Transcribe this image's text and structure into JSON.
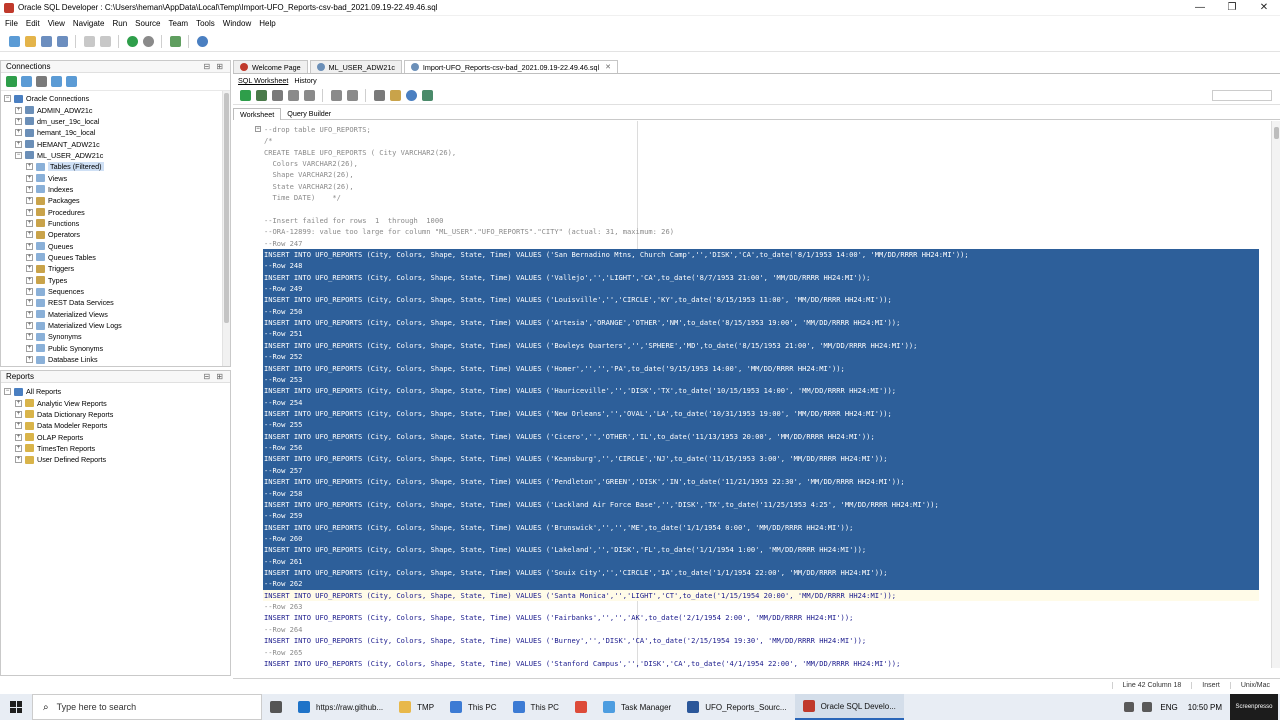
{
  "window": {
    "title": "Oracle SQL Developer : C:\\Users\\heman\\AppData\\Local\\Temp\\Import-UFO_Reports-csv-bad_2021.09.19-22.49.46.sql",
    "min": "—",
    "max": "❐",
    "close": "✕"
  },
  "menu": [
    "File",
    "Edit",
    "View",
    "Navigate",
    "Run",
    "Source",
    "Team",
    "Tools",
    "Window",
    "Help"
  ],
  "connections": {
    "title": "Connections",
    "controls": "⊟ ⊞",
    "items": [
      {
        "label": "Oracle Connections",
        "level": 0,
        "exp": "−",
        "icon": "#4a7fc1"
      },
      {
        "label": "ADMIN_ADW21c",
        "level": 1,
        "exp": "+",
        "icon": "#6b8fb8"
      },
      {
        "label": "dm_user_19c_local",
        "level": 1,
        "exp": "+",
        "icon": "#6b8fb8"
      },
      {
        "label": "hemant_19c_local",
        "level": 1,
        "exp": "+",
        "icon": "#6b8fb8"
      },
      {
        "label": "HEMANT_ADW21c",
        "level": 1,
        "exp": "+",
        "icon": "#6b8fb8"
      },
      {
        "label": "ML_USER_ADW21c",
        "level": 1,
        "exp": "−",
        "icon": "#6b8fb8"
      },
      {
        "label": "Tables (Filtered)",
        "level": 2,
        "exp": "+",
        "icon": "#8ab0d8",
        "selected": true
      },
      {
        "label": "Views",
        "level": 2,
        "exp": "+",
        "icon": "#8ab0d8"
      },
      {
        "label": "Indexes",
        "level": 2,
        "exp": "+",
        "icon": "#8ab0d8"
      },
      {
        "label": "Packages",
        "level": 2,
        "exp": "+",
        "icon": "#c9a34a"
      },
      {
        "label": "Procedures",
        "level": 2,
        "exp": "+",
        "icon": "#c9a34a"
      },
      {
        "label": "Functions",
        "level": 2,
        "exp": "+",
        "icon": "#c9a34a"
      },
      {
        "label": "Operators",
        "level": 2,
        "exp": "+",
        "icon": "#c9a34a"
      },
      {
        "label": "Queues",
        "level": 2,
        "exp": "+",
        "icon": "#8ab0d8"
      },
      {
        "label": "Queues Tables",
        "level": 2,
        "exp": "+",
        "icon": "#8ab0d8"
      },
      {
        "label": "Triggers",
        "level": 2,
        "exp": "+",
        "icon": "#c9a34a"
      },
      {
        "label": "Types",
        "level": 2,
        "exp": "+",
        "icon": "#c9a34a"
      },
      {
        "label": "Sequences",
        "level": 2,
        "exp": "+",
        "icon": "#8ab0d8"
      },
      {
        "label": "REST Data Services",
        "level": 2,
        "exp": "+",
        "icon": "#8ab0d8"
      },
      {
        "label": "Materialized Views",
        "level": 2,
        "exp": "+",
        "icon": "#8ab0d8"
      },
      {
        "label": "Materialized View Logs",
        "level": 2,
        "exp": "+",
        "icon": "#8ab0d8"
      },
      {
        "label": "Synonyms",
        "level": 2,
        "exp": "+",
        "icon": "#8ab0d8"
      },
      {
        "label": "Public Synonyms",
        "level": 2,
        "exp": "+",
        "icon": "#8ab0d8"
      },
      {
        "label": "Database Links",
        "level": 2,
        "exp": "+",
        "icon": "#8ab0d8"
      }
    ]
  },
  "reports": {
    "title": "Reports",
    "controls": "⊟ ⊞",
    "items": [
      {
        "label": "All Reports",
        "level": 0,
        "exp": "−",
        "icon": "#4a7fc1"
      },
      {
        "label": "Analytic View Reports",
        "level": 1,
        "exp": "+",
        "icon": "#d9b44a"
      },
      {
        "label": "Data Dictionary Reports",
        "level": 1,
        "exp": "+",
        "icon": "#d9b44a"
      },
      {
        "label": "Data Modeler Reports",
        "level": 1,
        "exp": "+",
        "icon": "#d9b44a"
      },
      {
        "label": "OLAP Reports",
        "level": 1,
        "exp": "+",
        "icon": "#d9b44a"
      },
      {
        "label": "TimesTen Reports",
        "level": 1,
        "exp": "+",
        "icon": "#d9b44a"
      },
      {
        "label": "User Defined Reports",
        "level": 1,
        "exp": "+",
        "icon": "#d9b44a"
      }
    ]
  },
  "doc_tabs": [
    {
      "label": "Welcome Page",
      "icon": "#c0392b",
      "active": false
    },
    {
      "label": "ML_USER_ADW21c",
      "icon": "#6b8fb8",
      "active": false
    },
    {
      "label": "Import-UFO_Reports-csv-bad_2021.09.19-22.49.46.sql",
      "icon": "#6b8fb8",
      "active": true
    }
  ],
  "sub_tabs": [
    "SQL Worksheet",
    "History"
  ],
  "ws_tabs": [
    "Worksheet",
    "Query Builder"
  ],
  "code_lines": [
    {
      "t": "--drop table UFO_REPORTS;",
      "s": "c"
    },
    {
      "t": "/*",
      "s": "c"
    },
    {
      "t": "CREATE TABLE UFO_REPORTS ( City VARCHAR2(26),",
      "s": "c"
    },
    {
      "t": "  Colors VARCHAR2(26),",
      "s": "c"
    },
    {
      "t": "  Shape VARCHAR2(26),",
      "s": "c"
    },
    {
      "t": "  State VARCHAR2(26),",
      "s": "c"
    },
    {
      "t": "  Time DATE)    */",
      "s": "c"
    },
    {
      "t": "",
      "s": "c"
    },
    {
      "t": "--Insert failed for rows  1  through  1000",
      "s": "c"
    },
    {
      "t": "--ORA-12899: value too large for column \"ML_USER\".\"UFO_REPORTS\".\"CITY\" (actual: 31, maximum: 26)",
      "s": "c"
    },
    {
      "t": "--Row 247",
      "s": "c"
    },
    {
      "t": "INSERT INTO UFO_REPORTS (City, Colors, Shape, State, Time) VALUES ('San Bernadino Mtns, Church Camp','','DISK','CA',to_date('8/1/1953 14:00', 'MM/DD/RRRR HH24:MI'));",
      "s": "hl"
    },
    {
      "t": "--Row 248",
      "s": "hl"
    },
    {
      "t": "INSERT INTO UFO_REPORTS (City, Colors, Shape, State, Time) VALUES ('Vallejo','','LIGHT','CA',to_date('8/7/1953 21:00', 'MM/DD/RRRR HH24:MI'));",
      "s": "hl"
    },
    {
      "t": "--Row 249",
      "s": "hl"
    },
    {
      "t": "INSERT INTO UFO_REPORTS (City, Colors, Shape, State, Time) VALUES ('Louisville','','CIRCLE','KY',to_date('8/15/1953 11:00', 'MM/DD/RRRR HH24:MI'));",
      "s": "hl"
    },
    {
      "t": "--Row 250",
      "s": "hl"
    },
    {
      "t": "INSERT INTO UFO_REPORTS (City, Colors, Shape, State, Time) VALUES ('Artesia','ORANGE','OTHER','NM',to_date('8/15/1953 19:00', 'MM/DD/RRRR HH24:MI'));",
      "s": "hl"
    },
    {
      "t": "--Row 251",
      "s": "hl"
    },
    {
      "t": "INSERT INTO UFO_REPORTS (City, Colors, Shape, State, Time) VALUES ('Bowleys Quarters','','SPHERE','MD',to_date('8/15/1953 21:00', 'MM/DD/RRRR HH24:MI'));",
      "s": "hl"
    },
    {
      "t": "--Row 252",
      "s": "hl"
    },
    {
      "t": "INSERT INTO UFO_REPORTS (City, Colors, Shape, State, Time) VALUES ('Homer','','','PA',to_date('9/15/1953 14:00', 'MM/DD/RRRR HH24:MI'));",
      "s": "hl"
    },
    {
      "t": "--Row 253",
      "s": "hl"
    },
    {
      "t": "INSERT INTO UFO_REPORTS (City, Colors, Shape, State, Time) VALUES ('Hauriceville','','DISK','TX',to_date('10/15/1953 14:00', 'MM/DD/RRRR HH24:MI'));",
      "s": "hl"
    },
    {
      "t": "--Row 254",
      "s": "hl"
    },
    {
      "t": "INSERT INTO UFO_REPORTS (City, Colors, Shape, State, Time) VALUES ('New Orleans','','OVAL','LA',to_date('10/31/1953 19:00', 'MM/DD/RRRR HH24:MI'));",
      "s": "hl"
    },
    {
      "t": "--Row 255",
      "s": "hl"
    },
    {
      "t": "INSERT INTO UFO_REPORTS (City, Colors, Shape, State, Time) VALUES ('Cicero','','OTHER','IL',to_date('11/13/1953 20:00', 'MM/DD/RRRR HH24:MI'));",
      "s": "hl"
    },
    {
      "t": "--Row 256",
      "s": "hl"
    },
    {
      "t": "INSERT INTO UFO_REPORTS (City, Colors, Shape, State, Time) VALUES ('Keansburg','','CIRCLE','NJ',to_date('11/15/1953 3:00', 'MM/DD/RRRR HH24:MI'));",
      "s": "hl"
    },
    {
      "t": "--Row 257",
      "s": "hl"
    },
    {
      "t": "INSERT INTO UFO_REPORTS (City, Colors, Shape, State, Time) VALUES ('Pendleton','GREEN','DISK','IN',to_date('11/21/1953 22:30', 'MM/DD/RRRR HH24:MI'));",
      "s": "hl"
    },
    {
      "t": "--Row 258",
      "s": "hl"
    },
    {
      "t": "INSERT INTO UFO_REPORTS (City, Colors, Shape, State, Time) VALUES ('Lackland Air Force Base','','DISK','TX',to_date('11/25/1953 4:25', 'MM/DD/RRRR HH24:MI'));",
      "s": "hl"
    },
    {
      "t": "--Row 259",
      "s": "hl"
    },
    {
      "t": "INSERT INTO UFO_REPORTS (City, Colors, Shape, State, Time) VALUES ('Brunswick','','','ME',to_date('1/1/1954 0:00', 'MM/DD/RRRR HH24:MI'));",
      "s": "hl"
    },
    {
      "t": "--Row 260",
      "s": "hl"
    },
    {
      "t": "INSERT INTO UFO_REPORTS (City, Colors, Shape, State, Time) VALUES ('Lakeland','','DISK','FL',to_date('1/1/1954 1:00', 'MM/DD/RRRR HH24:MI'));",
      "s": "hl"
    },
    {
      "t": "--Row 261",
      "s": "hl"
    },
    {
      "t": "INSERT INTO UFO_REPORTS (City, Colors, Shape, State, Time) VALUES ('Souix City','','CIRCLE','IA',to_date('1/1/1954 22:00', 'MM/DD/RRRR HH24:MI'));",
      "s": "hl"
    },
    {
      "t": "--Row 262",
      "s": "hl"
    },
    {
      "t": "INSERT INTO UFO_REPORTS (City, Colors, Shape, State, Time) VALUES ('Santa Monica','','LIGHT','CT',to_date('1/15/1954 20:00', 'MM/DD/RRRR HH24:MI'));",
      "s": "cur"
    },
    {
      "t": "--Row 263",
      "s": "c"
    },
    {
      "t": "INSERT INTO UFO_REPORTS (City, Colors, Shape, State, Time) VALUES ('Fairbanks','','','AK',to_date('2/1/1954 2:00', 'MM/DD/RRRR HH24:MI'));",
      "s": "k"
    },
    {
      "t": "--Row 264",
      "s": "c"
    },
    {
      "t": "INSERT INTO UFO_REPORTS (City, Colors, Shape, State, Time) VALUES ('Burney','','DISK','CA',to_date('2/15/1954 19:30', 'MM/DD/RRRR HH24:MI'));",
      "s": "k"
    },
    {
      "t": "--Row 265",
      "s": "c"
    },
    {
      "t": "INSERT INTO UFO_REPORTS (City, Colors, Shape, State, Time) VALUES ('Stanford Campus','','DISK','CA',to_date('4/1/1954 22:00', 'MM/DD/RRRR HH24:MI'));",
      "s": "k"
    }
  ],
  "status": {
    "position": "Line 42 Column 18",
    "mode": "Insert",
    "line_ending": "Unix/Mac"
  },
  "taskbar": {
    "search_placeholder": "Type here to search",
    "items": [
      {
        "label": "",
        "icon": "#555555",
        "name": "task-view"
      },
      {
        "label": "https://raw.github...",
        "icon": "#1e73c8",
        "name": "edge-browser"
      },
      {
        "label": "TMP",
        "icon": "#e8b84a",
        "name": "explorer-tmp"
      },
      {
        "label": "This PC",
        "icon": "#3c7bd4",
        "name": "explorer-this-pc-1"
      },
      {
        "label": "This PC",
        "icon": "#3c7bd4",
        "name": "explorer-this-pc-2"
      },
      {
        "label": "",
        "icon": "#dd4b39",
        "name": "chrome"
      },
      {
        "label": "Task Manager",
        "icon": "#4d9de0",
        "name": "task-manager"
      },
      {
        "label": "UFO_Reports_Sourc...",
        "icon": "#2b579a",
        "name": "ufo-reports-source"
      },
      {
        "label": "Oracle SQL Develo...",
        "icon": "#c0392b",
        "name": "oracle-sql-developer",
        "active": true
      }
    ],
    "tray_lang": "ENG",
    "time": "10:50 PM",
    "badge": "Screenpresso"
  },
  "colors": {
    "selection": "#2d5f9a",
    "accent": "#2a66b8"
  }
}
